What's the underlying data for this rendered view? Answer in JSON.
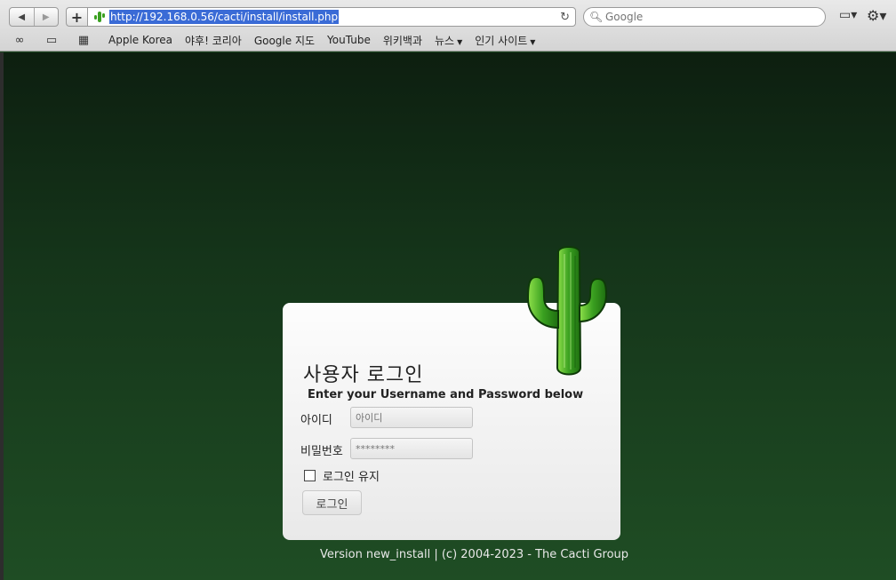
{
  "browser": {
    "url": "http://192.168.0.56/cacti/install/install.php",
    "search_placeholder": "Google",
    "bookmarks": [
      "Apple Korea",
      "야후! 코리아",
      "Google 지도",
      "YouTube",
      "위키백과",
      "뉴스",
      "인기 사이트"
    ],
    "icons": [
      "back-icon",
      "forward-icon",
      "add-icon",
      "reload-icon",
      "search-icon",
      "reading-list-icon",
      "bookmarks-icon",
      "top-sites-icon",
      "page-menu-icon",
      "settings-icon"
    ]
  },
  "login": {
    "title": "사용자 로그인",
    "subtitle": "Enter your Username and Password below",
    "username_label": "아이디",
    "username_placeholder": "아이디",
    "password_label": "비밀번호",
    "password_placeholder": "********",
    "remember_label": "로그인 유지",
    "remember_checked": false,
    "button_label": "로그인"
  },
  "footer": {
    "version": "Version new_install | (c) 2004-2023 - The Cacti Group"
  },
  "colors": {
    "background_top": "#0d1f10",
    "background_bottom": "#1f4d24",
    "cactus_green": "#3aa020",
    "url_highlight": "#3a6bd6"
  }
}
